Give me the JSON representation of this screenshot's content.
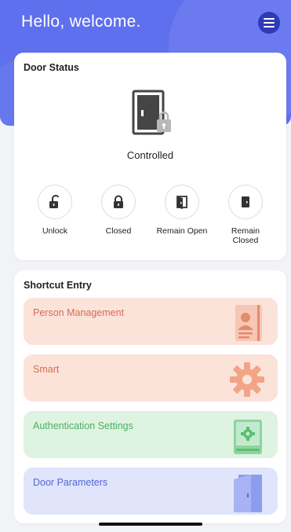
{
  "header": {
    "greeting": "Hello, welcome.",
    "menu_icon": "hamburger-menu-icon"
  },
  "door_status": {
    "title": "Door Status",
    "status": "Controlled",
    "controls": [
      {
        "label": "Unlock",
        "icon": "unlock-icon"
      },
      {
        "label": "Closed",
        "icon": "lock-icon"
      },
      {
        "label": "Remain Open",
        "icon": "door-open-icon"
      },
      {
        "label": "Remain Closed",
        "icon": "door-closed-icon"
      }
    ]
  },
  "shortcut": {
    "title": "Shortcut Entry",
    "items": [
      {
        "label": "Person Management",
        "color": "#d86a50",
        "bg": "#fbe3da"
      },
      {
        "label": "Smart",
        "color": "#d86a50",
        "bg": "#fbe3da"
      },
      {
        "label": "Authentication Settings",
        "color": "#4caf62",
        "bg": "#def3e1"
      },
      {
        "label": "Door Parameters",
        "color": "#5566d8",
        "bg": "#e0e5fb"
      }
    ]
  },
  "colors": {
    "header": "#5f70ee",
    "menu_button": "#2f3ab8"
  }
}
